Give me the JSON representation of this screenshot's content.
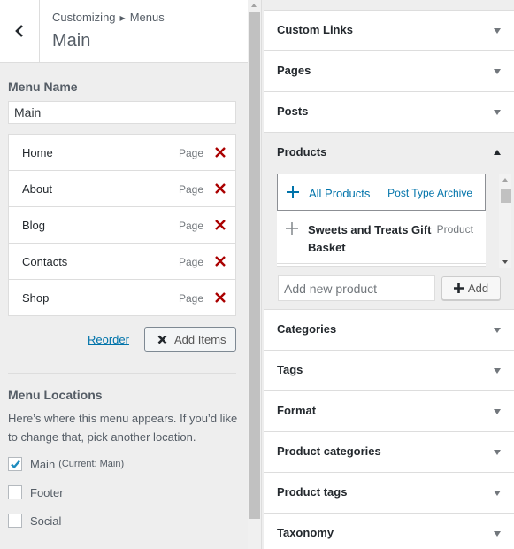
{
  "header": {
    "breadcrumb_root": "Customizing",
    "breadcrumb_child": "Menus",
    "title": "Main",
    "back_icon": "chevron-left-icon"
  },
  "menu_name": {
    "label": "Menu Name",
    "value": "Main"
  },
  "menu_items": [
    {
      "name": "Home",
      "type": "Page"
    },
    {
      "name": "About",
      "type": "Page"
    },
    {
      "name": "Blog",
      "type": "Page"
    },
    {
      "name": "Contacts",
      "type": "Page"
    },
    {
      "name": "Shop",
      "type": "Page"
    }
  ],
  "actions": {
    "reorder": "Reorder",
    "add_items": "Add Items"
  },
  "locations": {
    "label": "Menu Locations",
    "description": "Here’s where this menu appears. If you’d like to change that, pick another location.",
    "options": [
      {
        "label": "Main",
        "note": "(Current: Main)",
        "checked": true
      },
      {
        "label": "Footer",
        "note": "",
        "checked": false
      },
      {
        "label": "Social",
        "note": "",
        "checked": false
      }
    ]
  },
  "available_sections": [
    {
      "title": "Custom Links",
      "expanded": false
    },
    {
      "title": "Pages",
      "expanded": false
    },
    {
      "title": "Posts",
      "expanded": false
    },
    {
      "title": "Products",
      "expanded": true
    },
    {
      "title": "Categories",
      "expanded": false
    },
    {
      "title": "Tags",
      "expanded": false
    },
    {
      "title": "Format",
      "expanded": false
    },
    {
      "title": "Product categories",
      "expanded": false
    },
    {
      "title": "Product tags",
      "expanded": false
    },
    {
      "title": "Taxonomy",
      "expanded": false
    }
  ],
  "products": {
    "items": [
      {
        "name": "All Products",
        "type": "Post Type Archive"
      },
      {
        "name": "Sweets and Treats Gift Basket",
        "type": "Product"
      }
    ],
    "new_placeholder": "Add new product",
    "add_label": "Add"
  },
  "colors": {
    "accent": "#0073aa",
    "delete": "#a00",
    "checkmark": "#1e8cbe"
  }
}
